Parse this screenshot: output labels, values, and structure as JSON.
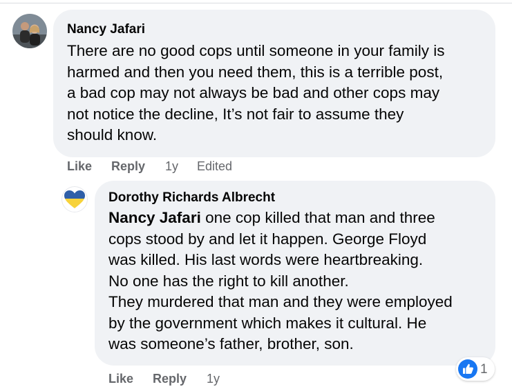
{
  "comments": [
    {
      "author": "Nancy Jafari",
      "lines": [
        "There are no good cops until someone in your family is",
        "harmed and then you need them, this is a terrible post,",
        "a bad cop may not always be bad and other cops may",
        "not notice the decline, It’s not fair to assume they",
        "should know."
      ],
      "actions": {
        "like": "Like",
        "reply": "Reply",
        "time": "1y",
        "edited": "Edited"
      }
    },
    {
      "author": "Dorothy Richards Albrecht",
      "mention": "Nancy Jafari",
      "lines": [
        " one cop killed that man and three",
        "cops stood by and let it happen. George Floyd",
        "was killed. His last words were heartbreaking.",
        "No one has the right to kill another.",
        "They murdered that man and they were employed",
        "by the government which makes it cultural. He",
        "was someone’s father, brother, son."
      ],
      "actions": {
        "like": "Like",
        "reply": "Reply",
        "time": "1y"
      },
      "reaction": {
        "icon": "like-icon",
        "count": "1"
      }
    }
  ],
  "colors": {
    "bubble": "#f0f2f5",
    "meta_text": "#65676b",
    "like_blue": "#1877f2",
    "heart_blue": "#2f5fa8",
    "heart_yellow": "#f7d23a"
  }
}
